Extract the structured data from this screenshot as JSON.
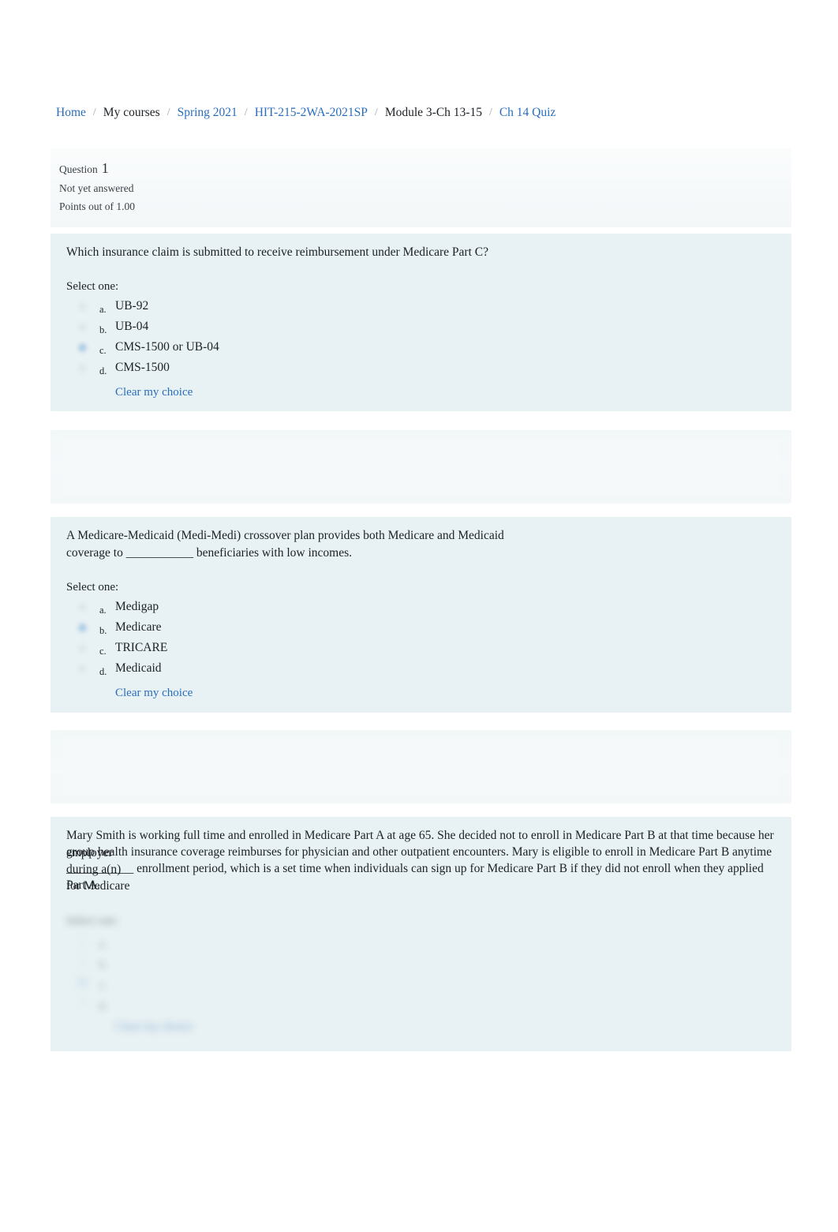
{
  "breadcrumb": {
    "separator": "/",
    "items": [
      {
        "label": "Home",
        "link": true
      },
      {
        "label": "My courses",
        "link": false
      },
      {
        "label": "Spring 2021",
        "link": true
      },
      {
        "label": "HIT-215-2WA-2021SP",
        "link": true
      },
      {
        "label": "Module 3-Ch 13-15",
        "link": false
      },
      {
        "label": "Ch 14 Quiz",
        "link": true
      }
    ]
  },
  "question_info": {
    "question_label": "Question",
    "question_number": "1",
    "status": "Not yet answered",
    "points": "Points out of 1.00"
  },
  "questions": [
    {
      "text": "Which insurance claim is submitted to receive reimbursement under Medicare Part C?",
      "select_prompt": "Select one:",
      "clear_label": "Clear my choice",
      "options": [
        {
          "letter": "a.",
          "label": "UB-92",
          "highlighted": false
        },
        {
          "letter": "b.",
          "label": "UB-04",
          "highlighted": false
        },
        {
          "letter": "c.",
          "label": "CMS-1500 or UB-04",
          "highlighted": true
        },
        {
          "letter": "d.",
          "label": "CMS-1500",
          "highlighted": false
        }
      ]
    },
    {
      "text_line1": "A Medicare-Medicaid (Medi-Medi) crossover plan provides both Medicare and Medicaid",
      "text_line2": "coverage to ___________ beneficiaries with low incomes.",
      "select_prompt": "Select one:",
      "clear_label": "Clear my choice",
      "options": [
        {
          "letter": "a.",
          "label": "Medigap",
          "highlighted": false
        },
        {
          "letter": "b.",
          "label": "Medicare",
          "highlighted": true
        },
        {
          "letter": "c.",
          "label": "TRICARE",
          "highlighted": false
        },
        {
          "letter": "d.",
          "label": "Medicaid",
          "highlighted": false
        }
      ]
    },
    {
      "text_line1": "Mary Smith is working full time and enrolled in Medicare Part A at age 65. She decided not to enroll in Medicare Part B at that time because her employer",
      "text_line2": "group health insurance coverage reimburses for physician and other outpatient encounters. Mary is eligible to enroll in Medicare Part B anytime during a(n)",
      "text_line3": "___________ enrollment period, which is a set time when individuals can sign up for Medicare Part B if they did not enroll when they applied for Medicare",
      "text_line4": "Part A.",
      "select_prompt": "Select one:",
      "clear_label": "Clear my choice",
      "obscured": true,
      "options": [
        {
          "letter": "a.",
          "label": "",
          "highlighted": false
        },
        {
          "letter": "b.",
          "label": "",
          "highlighted": false
        },
        {
          "letter": "c.",
          "label": "",
          "highlighted": true
        },
        {
          "letter": "d.",
          "label": "",
          "highlighted": false
        }
      ]
    }
  ],
  "colors": {
    "link": "#2a6ebb",
    "question_card_bg": "#e8f1f3",
    "info_card_bg": "#f6f9fa",
    "text": "#1d2125"
  }
}
